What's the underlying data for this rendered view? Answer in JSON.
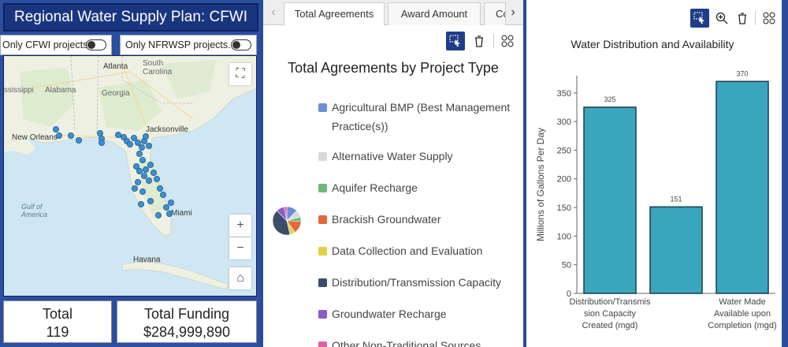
{
  "left": {
    "title": "Regional Water Supply Plan: CFWI",
    "toggles": [
      {
        "label": "Only CFWI projects."
      },
      {
        "label": "Only NFRWSP projects."
      }
    ],
    "map_labels": {
      "atlanta": "Atlanta",
      "south_carolina": "South\nCarolina",
      "mississippi": "ssissippi",
      "alabama": "Alabama",
      "georgia": "Georgia",
      "jacksonville": "Jacksonville",
      "new_orleans": "New Orleans",
      "gulf": "Gulf of\nAmerica",
      "miami": "Miami",
      "havana": "Havana"
    },
    "map_buttons": {
      "expand": "⛶",
      "zoom_in": "+",
      "zoom_out": "−",
      "home": "⌂"
    },
    "stats": [
      {
        "label": "Total",
        "value": "119"
      },
      {
        "label": "Total Funding",
        "value": "$284,999,890"
      }
    ]
  },
  "middle": {
    "tabs": [
      "Total Agreements",
      "Award Amount",
      "Co"
    ],
    "arrows": {
      "left": "‹",
      "right": "›"
    },
    "chart_title": "Total Agreements by Project Type",
    "legend": [
      {
        "label": "Agricultural BMP (Best Management Practice(s))",
        "color": "#6b8fd6"
      },
      {
        "label": "Alternative Water Supply",
        "color": "#d9d9d9"
      },
      {
        "label": "Aquifer Recharge",
        "color": "#6fb87a"
      },
      {
        "label": "Brackish Groundwater",
        "color": "#e06a3a"
      },
      {
        "label": "Data Collection and Evaluation",
        "color": "#e3d04a"
      },
      {
        "label": "Distribution/Transmission Capacity",
        "color": "#3d4c6b"
      },
      {
        "label": "Groundwater Recharge",
        "color": "#8a5cc7"
      },
      {
        "label": "Other Non-Traditional Sources",
        "color": "#e05fa0"
      }
    ],
    "toolbar_icons": [
      "select-icon",
      "delete-icon",
      "grid-icon"
    ]
  },
  "right": {
    "toolbar_icons": [
      "select-icon",
      "zoom-icon",
      "delete-icon",
      "grid-icon"
    ]
  },
  "chart_data": [
    {
      "type": "pie",
      "title": "Total Agreements by Project Type",
      "categories": [
        "Agricultural BMP (Best Management Practice(s))",
        "Alternative Water Supply",
        "Aquifer Recharge",
        "Brackish Groundwater",
        "Data Collection and Evaluation",
        "Distribution/Transmission Capacity",
        "Groundwater Recharge",
        "Other Non-Traditional Sources"
      ],
      "values": [
        12,
        8,
        5,
        14,
        6,
        40,
        9,
        3
      ],
      "colors": [
        "#6b8fd6",
        "#d9d9d9",
        "#6fb87a",
        "#e06a3a",
        "#e3d04a",
        "#3d4c6b",
        "#8a5cc7",
        "#e05fa0"
      ]
    },
    {
      "type": "bar",
      "title": "Water Distribution and Availability",
      "categories": [
        "Distribution/Transmission Capacity Created (mgd)",
        "",
        "Water Made Available upon Completion (mgd)"
      ],
      "category_label_lines": [
        [
          "Distribution/Transmis",
          "sion Capacity",
          "Created (mgd)"
        ],
        [],
        [
          "Water Made",
          "Available upon",
          "Completion (mgd)"
        ]
      ],
      "values": [
        325,
        151,
        370
      ],
      "data_labels": [
        "325",
        "151",
        "370"
      ],
      "ylabel": "Millions of Gallons Per Day",
      "ylim": [
        0,
        380
      ],
      "yticks": [
        0,
        50,
        100,
        150,
        200,
        250,
        300,
        350
      ],
      "bar_color": "#3aa6bd",
      "grid": false
    }
  ]
}
